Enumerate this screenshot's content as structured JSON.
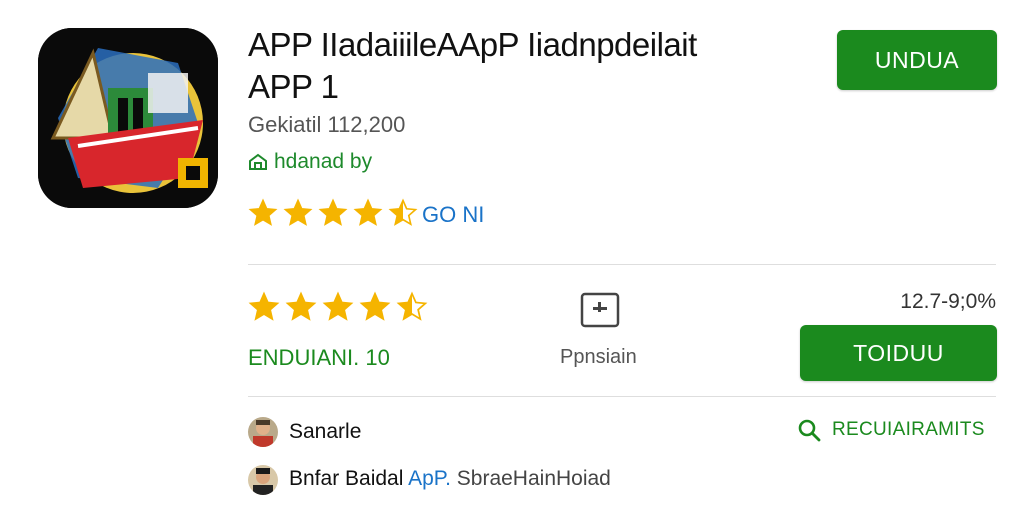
{
  "app": {
    "title_line1": "APP IIadaiiileAApP Iiadnpdeilait",
    "title_line2": "APP 1",
    "subtitle": "Gekiatil 112,200",
    "developer": "hdanad by",
    "developer_icon": "store-icon"
  },
  "header": {
    "install_button": "UNDUA",
    "top_rating_value": 4.5,
    "top_rating_max": 5,
    "top_rating_label": "GO NI"
  },
  "stats": {
    "rating_value": 4.5,
    "rating_max": 5,
    "rating_count": "ENDUIANI. 10",
    "permissions_icon": "permissions-icon",
    "permissions_label": "Ppnsiain",
    "size_label": "12.7-9;0%",
    "action_button": "TOIDUU"
  },
  "reviews": {
    "reviewer1": "Sanarle",
    "reviewer2_name": "Bnfar Baidal",
    "reviewer2_highlight": "ApP.",
    "reviewer2_rest": "SbraeHainHoiad",
    "requirements_link": "RECUIAIRAMITS",
    "requirements_icon": "search-icon"
  },
  "colors": {
    "accent_green": "#1b8a1e",
    "star_gold": "#f5b400",
    "link_blue": "#1a73c8"
  }
}
